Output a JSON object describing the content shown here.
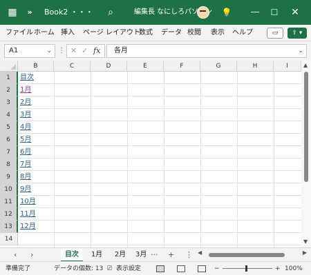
{
  "titlebar": {
    "app_icon": "excel-icon",
    "more_glyph": "»",
    "doc_title": "Book2 ・・・",
    "search_icon": "search-icon",
    "user_name": "編集長 なにしろパソコン",
    "lightbulb_icon": "lightbulb-icon",
    "colors": {
      "background": "#1e7145",
      "text": "#ffffff"
    }
  },
  "menu": {
    "items": [
      "ファイル",
      "ホーム",
      "挿入",
      "ページ レイアウト",
      "数式",
      "データ",
      "校閲",
      "表示",
      "ヘルプ"
    ],
    "comment_icon": "comment-icon",
    "share_icon": "share-icon"
  },
  "formula_bar": {
    "name_box": "A1",
    "fx_label": "fx",
    "content": "各月"
  },
  "grid": {
    "columns": [
      "B",
      "C",
      "D",
      "E",
      "F",
      "G",
      "H",
      "I"
    ],
    "rows": [
      "1",
      "2",
      "3",
      "4",
      "5",
      "6",
      "7",
      "8",
      "9",
      "10",
      "11",
      "12",
      "13",
      "14"
    ],
    "links": [
      "目次",
      "1月",
      "2月",
      "3月",
      "4月",
      "5月",
      "6月",
      "7月",
      "8月",
      "9月",
      "10月",
      "11月",
      "12月"
    ]
  },
  "sheet_tabs": {
    "tabs": [
      "目次",
      "1月",
      "2月",
      "3月"
    ],
    "active_index": 0,
    "more": "···",
    "add": "+",
    "menu": "⋮"
  },
  "status_bar": {
    "ready": "準備完了",
    "count": "データの個数: 13",
    "display_settings": "表示設定",
    "zoom": "100%",
    "zoom_minus": "−",
    "zoom_plus": "+"
  }
}
